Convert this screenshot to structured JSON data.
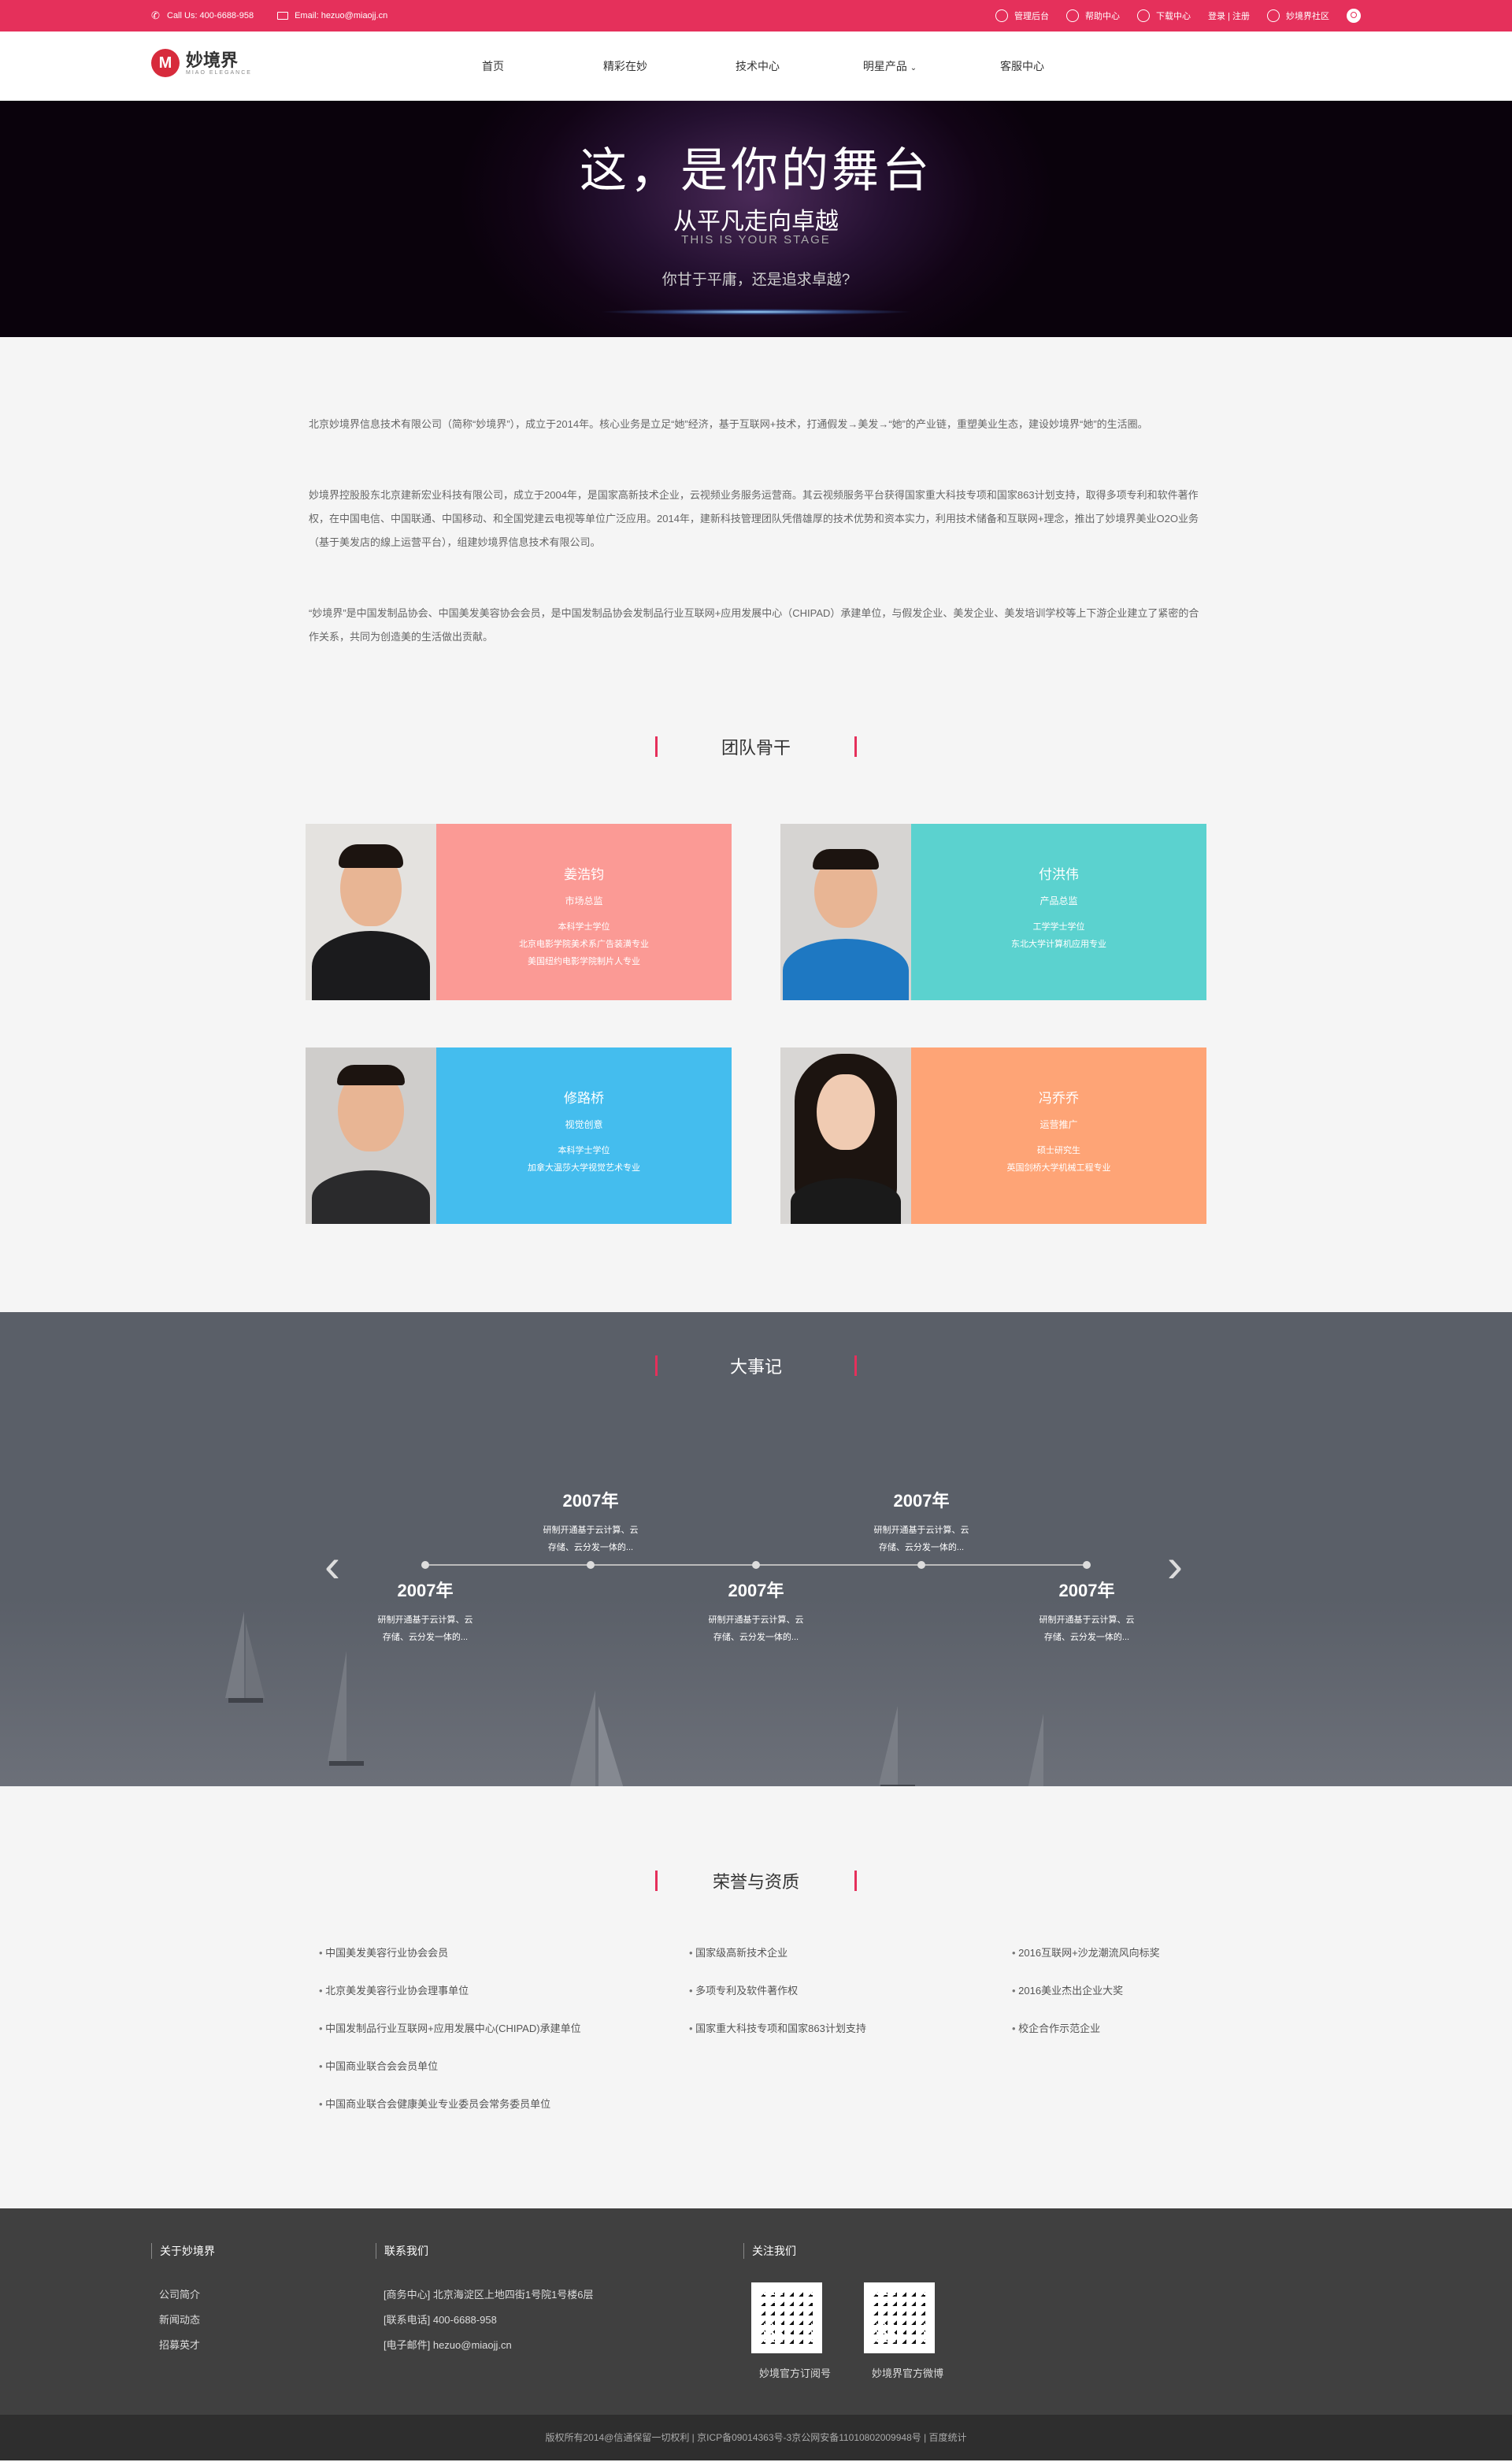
{
  "topbar": {
    "phone": "Call Us:  400-6688-958",
    "email": "Email:  hezuo@miaojj.cn",
    "links": [
      "管理后台",
      "帮助中心",
      "下载中心",
      "登录 | 注册",
      "妙境界社区"
    ]
  },
  "logo": {
    "name": "妙境界",
    "sub": "MIAO ELEGANCE"
  },
  "nav": [
    "首页",
    "精彩在妙",
    "技术中心",
    "明星产品",
    "客服中心"
  ],
  "banner": {
    "title": "这，是你的舞台",
    "subtitle": "从平凡走向卓越",
    "en": "THIS IS YOUR STAGE",
    "slogan": "你甘于平庸，还是追求卓越?"
  },
  "intro": [
    "北京妙境界信息技术有限公司（简称“妙境界”），成立于2014年。核心业务是立足“她”经济，基于互联网+技术，打通假发→美发→“她”的产业链，重塑美业生态，建设妙境界“她”的生活圈。",
    "妙境界控股股东北京建新宏业科技有限公司，成立于2004年，是国家高新技术企业，云视频业务服务运营商。其云视频服务平台获得国家重大科技专项和国家863计划支持，取得多项专利和软件著作权，在中国电信、中国联通、中国移动、和全国党建云电视等单位广泛应用。2014年，建新科技管理团队凭借雄厚的技术优势和资本实力，利用技术储备和互联网+理念，推出了妙境界美业O2O业务（基于美发店的線上运营平台），组建妙境界信息技术有限公司。",
    "“妙境界”是中国发制品协会、中国美发美容协会会员，是中国发制品协会发制品行业互联网+应用发展中心（CHIPAD）承建单位，与假发企业、美发企业、美发培训学校等上下游企业建立了紧密的合作关系，共同为创造美的生活做出贡献。"
  ],
  "team": {
    "title": "团队骨干",
    "members": [
      {
        "name": "姜浩钧",
        "role": "市场总监",
        "desc": [
          "本科学士学位",
          "北京电影学院美术系广告装潢专业",
          "美国纽约电影学院制片人专业"
        ],
        "color": "#fb9a95"
      },
      {
        "name": "付洪伟",
        "role": "产品总监",
        "desc": [
          "工学学士学位",
          "东北大学计算机应用专业"
        ],
        "color": "#5bd2cf"
      },
      {
        "name": "修路桥",
        "role": "视觉创意",
        "desc": [
          "本科学士学位",
          "加拿大温莎大学视觉艺术专业"
        ],
        "color": "#44bdee"
      },
      {
        "name": "冯乔乔",
        "role": "运营推广",
        "desc": [
          "硕士研究生",
          "英国剑桥大学机械工程专业"
        ],
        "color": "#fea476"
      }
    ]
  },
  "events": {
    "title": "大事记",
    "items": [
      {
        "year": "2007年",
        "desc": [
          "研制开通基于云计算、云",
          "存储、云分发一体的..."
        ]
      },
      {
        "year": "2007年",
        "desc": [
          "研制开通基于云计算、云",
          "存储、云分发一体的..."
        ]
      },
      {
        "year": "2007年",
        "desc": [
          "研制开通基于云计算、云",
          "存储、云分发一体的..."
        ]
      },
      {
        "year": "2007年",
        "desc": [
          "研制开通基于云计算、云",
          "存储、云分发一体的..."
        ]
      },
      {
        "year": "2007年",
        "desc": [
          "研制开通基于云计算、云",
          "存储、云分发一体的..."
        ]
      }
    ]
  },
  "honors": {
    "title": "荣誉与资质",
    "col1": [
      "中国美发美容行业协会会员",
      "北京美发美容行业协会理事单位",
      "中国发制品行业互联网+应用发展中心(CHIPAD)承建单位",
      "中国商业联合会会员单位",
      "中国商业联合会健康美业专业委员会常务委员单位"
    ],
    "col2": [
      "国家级高新技术企业",
      "多项专利及软件著作权",
      "国家重大科技专项和国家863计划支持"
    ],
    "col3": [
      "2016互联网+沙龙潮流风向标奖",
      "2016美业杰出企业大奖",
      "校企合作示范企业"
    ]
  },
  "footer": {
    "about": {
      "title": "关于妙境界",
      "items": [
        "公司简介",
        "新闻动态",
        "招募英才"
      ]
    },
    "contact": {
      "title": "联系我们",
      "items": [
        "[商务中心] 北京海淀区上地四街1号院1号楼6层",
        "[联系电话] 400-6688-958",
        "[电子邮件] hezuo@miaojj.cn"
      ]
    },
    "follow": {
      "title": "关注我们",
      "qr1": "妙境官方订阅号",
      "qr2": "妙境界官方微博"
    },
    "copyright": "版权所有2014@信通保留一切权利 | 京ICP备09014363号-3京公网安备11010802009948号 | 百度统计"
  },
  "colors": {
    "accent": "#e5305b",
    "events_bg": "#555a63",
    "footer_bg": "#404040"
  }
}
